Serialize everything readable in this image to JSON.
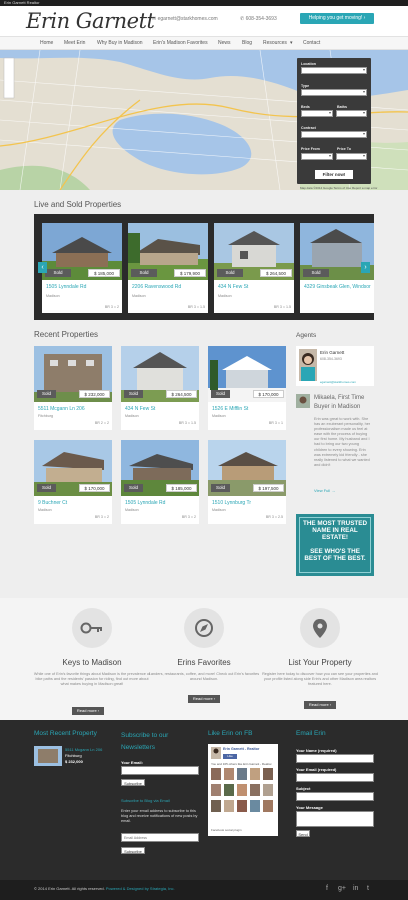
{
  "topbar": {
    "text": "Erin Garnett Realtor"
  },
  "header": {
    "logo": "Erin Garnett",
    "email": "egarnett@starkhomes.com",
    "phone": "608-354-3693",
    "cta": "Helping you get moving! ›"
  },
  "nav": {
    "items": [
      "Home",
      "Meet Erin",
      "Why Buy in Madison",
      "Erin's Madison Favorites",
      "News",
      "Blog",
      "Resources",
      "Contact"
    ]
  },
  "search": {
    "location": "Location",
    "type": "Type",
    "beds": "Beds",
    "baths": "Baths",
    "contract": "Contract",
    "price_from": "Price From",
    "price_to": "Price To",
    "button": "Filter now!"
  },
  "map": {
    "footer": "Map data ©2014 Google   Terms of Use   Report a map error"
  },
  "live_sold": {
    "title": "Live and Sold Properties",
    "items": [
      {
        "addr": "1505 Lynndale Rd",
        "city": "Madison",
        "status": "Sold",
        "price": "$ 185,000",
        "beds": "3",
        "baths": "2"
      },
      {
        "addr": "2206 Ravenswood Rd",
        "city": "Madison",
        "status": "Sold",
        "price": "$ 179,900",
        "beds": "3",
        "baths": "1.5"
      },
      {
        "addr": "434 N Few St",
        "city": "Madison",
        "status": "Sold",
        "price": "$ 264,500",
        "beds": "3",
        "baths": "1.5"
      },
      {
        "addr": "4329 Ginsbeak Glen, Windsor",
        "city": "Windsor",
        "status": "Sold",
        "price": "$ 315,000",
        "beds": "4",
        "baths": "3"
      }
    ]
  },
  "recent": {
    "title": "Recent Properties",
    "items": [
      {
        "addr": "5511 Mcgann Ln 206",
        "city": "Fitchburg",
        "status": "Sold",
        "price": "$ 232,000",
        "beds": "2",
        "baths": "2"
      },
      {
        "addr": "434 N Few St",
        "city": "Madison",
        "status": "Sold",
        "price": "$ 264,500",
        "beds": "3",
        "baths": "1.5"
      },
      {
        "addr": "1526 E Mifflin St",
        "city": "Madison",
        "status": "Sold",
        "price": "$ 170,000",
        "beds": "3",
        "baths": "1"
      },
      {
        "addr": "9 Buchner Ct",
        "city": "Madison",
        "status": "Sold",
        "price": "$ 170,000",
        "beds": "3",
        "baths": "2"
      },
      {
        "addr": "1505 Lynndale Rd",
        "city": "Madison",
        "status": "Sold",
        "price": "$ 185,000",
        "beds": "3",
        "baths": "2"
      },
      {
        "addr": "1510 Lynnburg Tr",
        "city": "Madison",
        "status": "Sold",
        "price": "$ 197,500",
        "beds": "3",
        "baths": "2.5"
      }
    ]
  },
  "agents": {
    "title": "Agents",
    "name": "Erin Garnett",
    "phone": "608-354-3693",
    "email": "egarnett@starkhomes.com"
  },
  "testimonial": {
    "title": "Mikaela, First Time Buyer in Madison",
    "text": "Erin was great to work with. She has an exuberant personality, her professionalism made us feel at ease with the process of buying our first home. My husband and I had to bring our two young children to every showing. Erin was extremely kid friendly - she really listened to what we wanted and didn't",
    "more": "View Full →"
  },
  "trusted": {
    "line1": "THE MOST TRUSTED NAME IN REAL ESTATE!",
    "line2": "SEE WHO'S THE BEST OF THE BEST."
  },
  "features": [
    {
      "title": "Keys to Madison",
      "text": "While one of Erin's favorite things about Madison is the prevalence of bike paths and the residents' passion for riding, find out more about what makes buying in Madison great!",
      "btn": "Read more ›",
      "icon": "key-icon"
    },
    {
      "title": "Erins Favorites",
      "text": "Landers, restaurants, coffee, and more! Check out Erin's favorites around Madison.",
      "btn": "Read more ›",
      "icon": "compass-icon"
    },
    {
      "title": "List Your Property",
      "text": "Register here today to discover how you can see your properties and your profile listed along side Erin's and other Madison area realtors featured here.",
      "btn": "Read more ›",
      "icon": "map-pin-icon"
    }
  ],
  "footer": {
    "col1_title": "Most Recent Property",
    "col1_addr": "5511 Mcgann Ln 206",
    "col1_city": "Fitchburg",
    "col1_price": "$ 232,000",
    "col2_title": "Subscribe to our Newsletters",
    "col2_email_label": "Your Email:",
    "col2_btn": "Subscribe",
    "col2_blog_title": "Subscribe to Blog via Email",
    "col2_blog_text": "Enter your email address to subscribe to this blog and receive notifications of new posts by email.",
    "col2_placeholder": "Email Address",
    "col2_btn2": "Subscribe",
    "col3_title": "Like Erin on FB",
    "col3_page": "Erin Garnett - Realtor",
    "col3_like": "Like",
    "col3_count": "You and 165 others like Erin Garnett - Realtor.",
    "col3_plugin": "Facebook social plugin",
    "col4_title": "Email Erin",
    "col4_name": "Your Name (required)",
    "col4_email": "Your Email (required)",
    "col4_subject": "Subject",
    "col4_message": "Your Message",
    "col4_btn": "Send"
  },
  "copyright": {
    "text": "© 2014 Erin Garnett. All rights reserved.",
    "credit": "Powered & Designed by Strategia, Inc."
  },
  "colors": {
    "accent": "#2aa6b5",
    "trusted_bg": "#2a8c93"
  }
}
